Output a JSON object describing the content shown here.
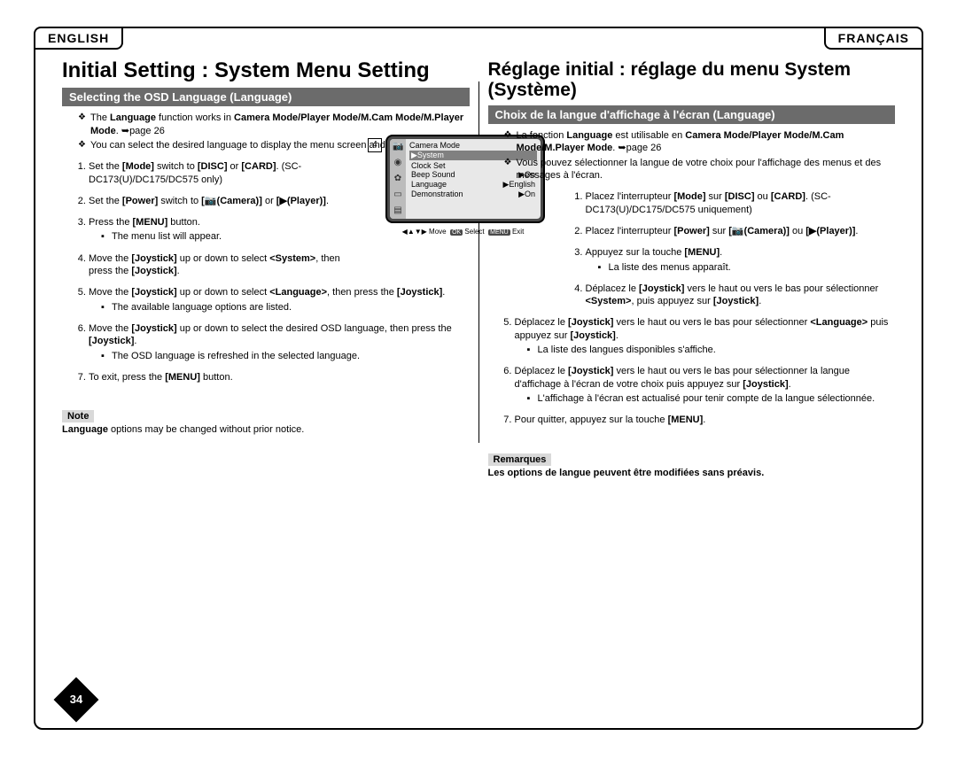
{
  "lang_left": "ENGLISH",
  "lang_right": "FRANÇAIS",
  "en": {
    "title": "Initial Setting : System Menu Setting",
    "subhead": "Selecting the OSD Language (Language)",
    "intro1_a": "The ",
    "intro1_b": "Language",
    "intro1_c": " function works in ",
    "intro1_d": "Camera Mode/Player Mode/M.Cam Mode/M.Player Mode",
    "intro1_e": ". ➥page 26",
    "intro2": "You can select the desired language to display the menu screen and the messages.",
    "s1_a": "Set the ",
    "s1_b": "[Mode]",
    "s1_c": " switch to ",
    "s1_d": "[DISC]",
    "s1_e": " or ",
    "s1_f": "[CARD]",
    "s1_g": ". (SC-DC173(U)/DC175/DC575 only)",
    "s2_a": "Set the ",
    "s2_b": "[Power]",
    "s2_c": " switch to ",
    "s2_d": "[📷(Camera)]",
    "s2_e": " or ",
    "s2_f": "[▶(Player)]",
    "s2_g": ".",
    "s3_a": "Press the ",
    "s3_b": "[MENU]",
    "s3_c": " button.",
    "s3_sub": "The menu list will appear.",
    "s4_a": "Move the ",
    "s4_b": "[Joystick]",
    "s4_c": " up or down to select ",
    "s4_d": "<System>",
    "s4_e": ", then press the ",
    "s4_f": "[Joystick]",
    "s4_g": ".",
    "s5_a": "Move the ",
    "s5_b": "[Joystick]",
    "s5_c": " up or down to select ",
    "s5_d": "<Language>",
    "s5_e": ", then press the ",
    "s5_f": "[Joystick]",
    "s5_g": ".",
    "s5_sub": "The available language options are listed.",
    "s6_a": "Move the ",
    "s6_b": "[Joystick]",
    "s6_c": " up or down to select the desired OSD language, then press the ",
    "s6_d": "[Joystick]",
    "s6_e": ".",
    "s6_sub": "The OSD language is refreshed in the selected language.",
    "s7_a": "To exit, press the ",
    "s7_b": "[MENU]",
    "s7_c": " button.",
    "note_label": "Note",
    "note_a": "Language",
    "note_b": " options may be changed without prior notice."
  },
  "fr": {
    "title": "Réglage initial : réglage du menu System (Système)",
    "subhead": "Choix de la langue d'affichage à l'écran (Language)",
    "intro1_a": "La fonction ",
    "intro1_b": "Language",
    "intro1_c": " est utilisable en ",
    "intro1_d": "Camera Mode/Player Mode/M.Cam Mode/M.Player Mode",
    "intro1_e": ". ➥page 26",
    "intro2": "Vous pouvez sélectionner la langue de votre choix pour l'affichage des menus et des messages à l'écran.",
    "s1_a": "Placez l'interrupteur ",
    "s1_b": "[Mode]",
    "s1_c": " sur ",
    "s1_d": "[DISC]",
    "s1_e": " ou ",
    "s1_f": "[CARD]",
    "s1_g": ". (SC-DC173(U)/DC175/DC575 uniquement)",
    "s2_a": "Placez l'interrupteur ",
    "s2_b": "[Power]",
    "s2_c": " sur ",
    "s2_d": "[📷(Camera)]",
    "s2_e": " ou ",
    "s2_f": "[▶(Player)]",
    "s2_g": ".",
    "s3_a": "Appuyez sur la touche ",
    "s3_b": "[MENU]",
    "s3_c": ".",
    "s3_sub": "La liste des menus apparaît.",
    "s4_a": "Déplacez le ",
    "s4_b": "[Joystick]",
    "s4_c": " vers le haut ou vers le bas pour sélectionner ",
    "s4_d": "<System>",
    "s4_e": ", puis appuyez sur ",
    "s4_f": "[Joystick]",
    "s4_g": ".",
    "s5_a": "Déplacez le ",
    "s5_b": "[Joystick]",
    "s5_c": " vers le haut ou vers le bas pour sélectionner ",
    "s5_d": "<Language>",
    "s5_e": " puis appuyez sur ",
    "s5_f": "[Joystick]",
    "s5_g": ".",
    "s5_sub": "La liste des langues disponibles s'affiche.",
    "s6_a": "Déplacez le ",
    "s6_b": "[Joystick]",
    "s6_c": " vers le haut ou vers le bas pour sélectionner la langue d'affichage à l'écran de votre choix puis appuyez sur ",
    "s6_d": "[Joystick]",
    "s6_e": ".",
    "s6_sub": "L'affichage à l'écran est actualisé pour tenir compte de la langue sélectionnée.",
    "s7_a": "Pour quitter, appuyez sur la touche ",
    "s7_b": "[MENU]",
    "s7_c": ".",
    "note_label": "Remarques",
    "note": "Les options de langue peuvent être modifiées sans préavis."
  },
  "osd": {
    "num": "4",
    "title": "Camera Mode",
    "selected": "▶System",
    "rows": [
      {
        "l": "Clock Set",
        "r": ""
      },
      {
        "l": "Beep Sound",
        "r": "▶On"
      },
      {
        "l": "Language",
        "r": "▶English"
      },
      {
        "l": "Demonstration",
        "r": "▶On"
      }
    ],
    "nav_move": "Move",
    "nav_select": "Select",
    "nav_exit": "Exit",
    "nav_ok": "OK",
    "nav_menu": "MENU"
  },
  "page_number": "34"
}
